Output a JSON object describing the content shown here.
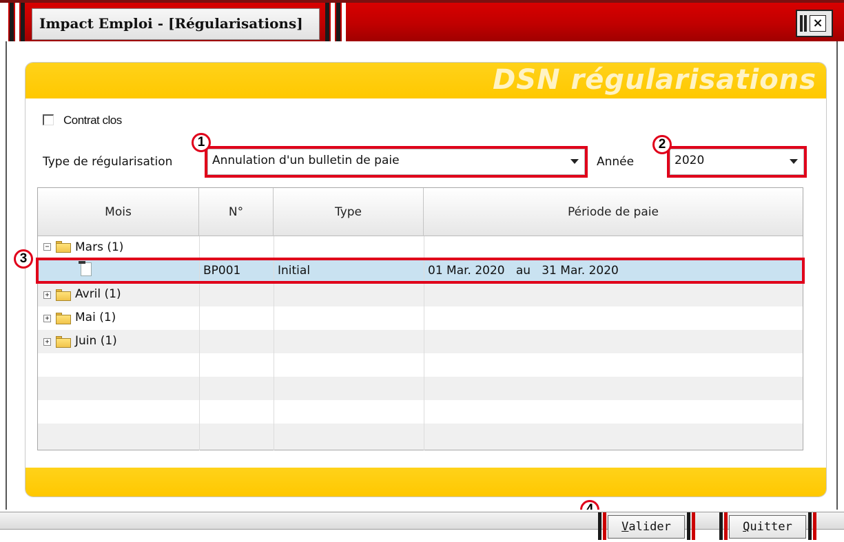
{
  "window": {
    "title": "Impact Emploi - [Régularisations]",
    "close_symbol": "×"
  },
  "panel": {
    "title": "DSN régularisations"
  },
  "form": {
    "contrat_clos_label": "Contrat clos",
    "contrat_clos_checked": false,
    "type_label": "Type de régularisation",
    "type_value": "Annulation d'un bulletin de paie",
    "annee_label": "Année",
    "annee_value": "2020"
  },
  "grid": {
    "columns": [
      "Mois",
      "N°",
      "Type",
      "Période de paie"
    ],
    "rows": [
      {
        "mois": "Mars (1)",
        "expander": "−",
        "expanded": true
      },
      {
        "mois": "",
        "numero": "BP001",
        "type": "Initial",
        "periode": "01 Mar. 2020   au   31 Mar. 2020",
        "selected": true
      },
      {
        "mois": "Avril (1)",
        "expander": "+",
        "expanded": false
      },
      {
        "mois": "Mai (1)",
        "expander": "+",
        "expanded": false
      },
      {
        "mois": "Juin (1)",
        "expander": "+",
        "expanded": false
      }
    ]
  },
  "annotations": [
    "1",
    "2",
    "3",
    "4"
  ],
  "buttons": {
    "valider_first": "V",
    "valider_rest": "alider",
    "quitter_first": "Q",
    "quitter_rest": "uitter"
  },
  "colors": {
    "title_red": "#c00000",
    "panel_yellow": "#ffc800",
    "selection_blue": "#c9e2f1",
    "annotation_red": "#e0001a"
  },
  "icons": [
    "folder-icon",
    "document-icon",
    "expand-icon",
    "collapse-icon",
    "close-icon",
    "dropdown-arrow-icon"
  ]
}
